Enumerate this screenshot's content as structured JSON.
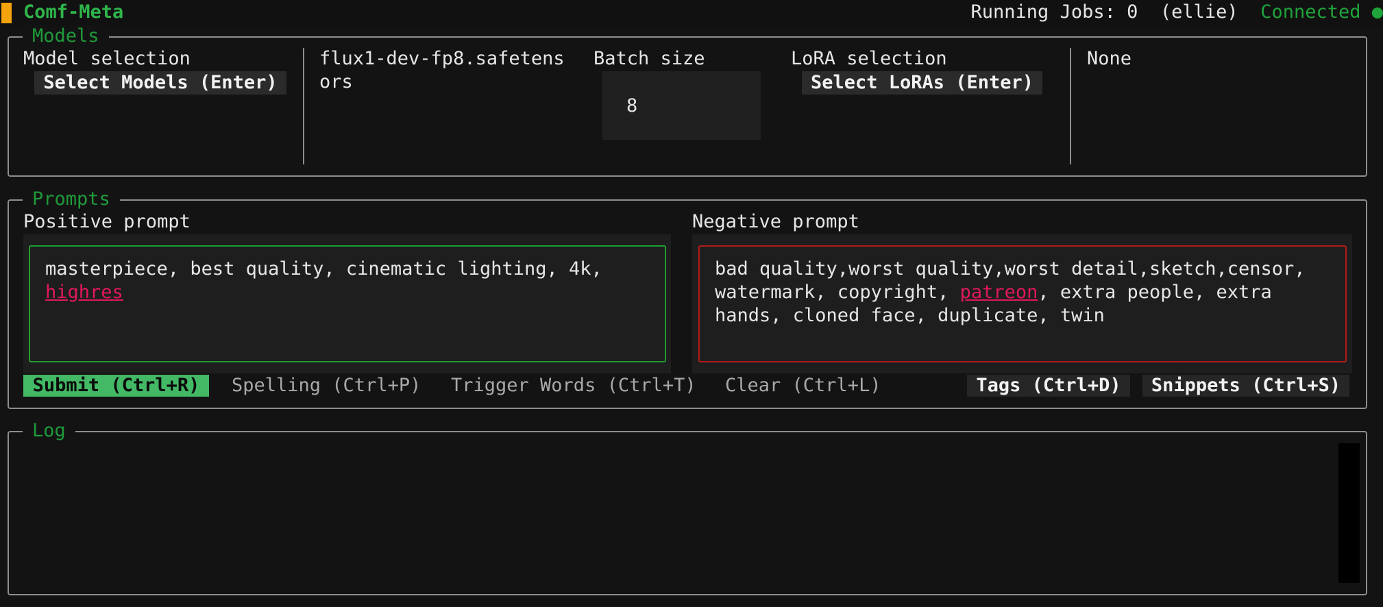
{
  "header": {
    "title": "Comf-Meta",
    "running_jobs": "Running Jobs: 0",
    "user": "(ellie)",
    "connection": "Connected ●"
  },
  "models": {
    "panel_title": "Models",
    "model_selection_label": "Model selection",
    "select_models_button": "Select Models (Enter)",
    "selected_model": "flux1-dev-fp8.safetensors",
    "batch_size_label": "Batch size",
    "batch_size_value": "8",
    "lora_selection_label": "LoRA selection",
    "select_loras_button": "Select LoRAs (Enter)",
    "selected_lora": "None"
  },
  "prompts": {
    "panel_title": "Prompts",
    "positive_label": "Positive prompt",
    "positive_text_before": "masterpiece, best quality, cinematic lighting, 4k, ",
    "positive_misspelled": "highres",
    "negative_label": "Negative prompt",
    "negative_text_before": "bad quality,worst quality,worst detail,sketch,censor, watermark, copyright, ",
    "negative_misspelled": "patreon",
    "negative_text_after": ", extra people, extra hands, cloned face, duplicate, twin",
    "actions": {
      "submit": "Submit (Ctrl+R)",
      "spelling": "Spelling (Ctrl+P)",
      "trigger_words": "Trigger Words (Ctrl+T)",
      "clear": "Clear (Ctrl+L)",
      "tags": "Tags (Ctrl+D)",
      "snippets": "Snippets (Ctrl+S)"
    }
  },
  "log": {
    "panel_title": "Log"
  },
  "colors": {
    "accent_green": "#1f9a3a",
    "submit_green": "#43b865",
    "warning_orange": "#f5a30c",
    "negative_red": "#b31b1b",
    "misspell_pink": "#e0185c"
  }
}
